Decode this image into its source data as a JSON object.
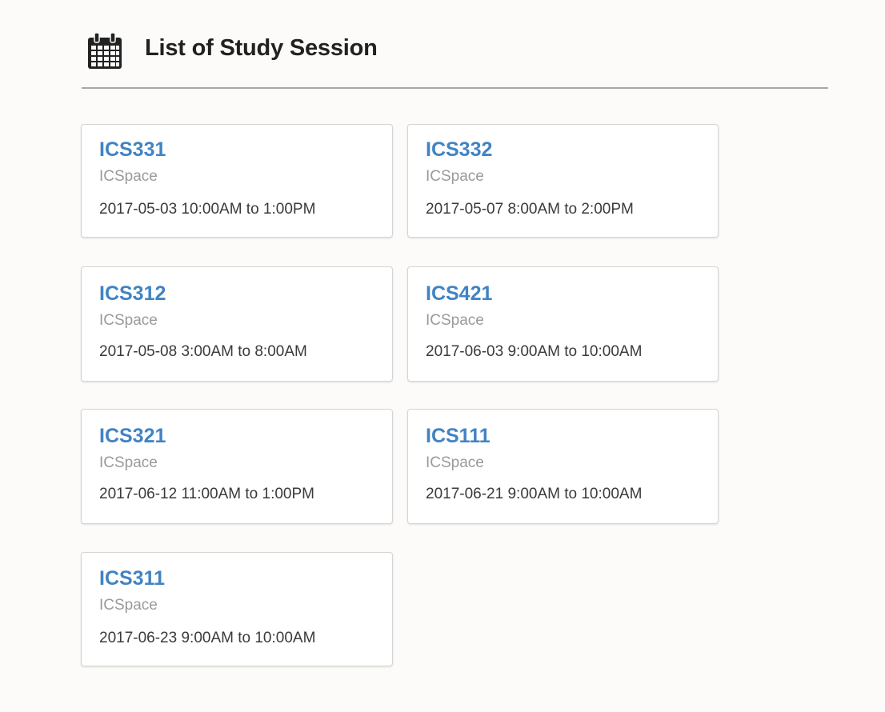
{
  "header": {
    "icon": "calendar-icon",
    "title": "List of Study Session"
  },
  "sessions": [
    {
      "course": "ICS331",
      "location": "ICSpace",
      "time": "2017-05-03 10:00AM to 1:00PM"
    },
    {
      "course": "ICS332",
      "location": "ICSpace",
      "time": "2017-05-07 8:00AM to 2:00PM"
    },
    {
      "course": "ICS312",
      "location": "ICSpace",
      "time": "2017-05-08 3:00AM to 8:00AM"
    },
    {
      "course": "ICS421",
      "location": "ICSpace",
      "time": "2017-06-03 9:00AM to 10:00AM"
    },
    {
      "course": "ICS321",
      "location": "ICSpace",
      "time": "2017-06-12 11:00AM to 1:00PM"
    },
    {
      "course": "ICS111",
      "location": "ICSpace",
      "time": "2017-06-21 9:00AM to 10:00AM"
    },
    {
      "course": "ICS311",
      "location": "ICSpace",
      "time": "2017-06-23 9:00AM to 10:00AM"
    }
  ],
  "colors": {
    "link": "#4183c4",
    "meta": "#9a9a9a",
    "background": "#fcfbf9"
  }
}
